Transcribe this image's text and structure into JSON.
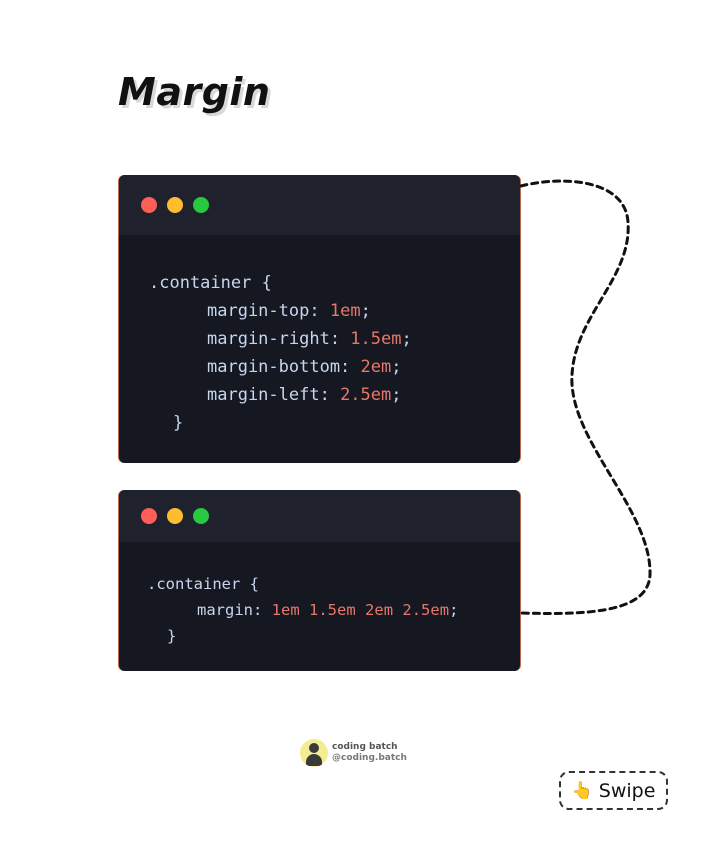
{
  "title": "Margin",
  "colors": {
    "window_bg": "#151821",
    "titlebar_bg": "#1f222c",
    "code_text": "#c7d6ee",
    "number_accent": "#e8776b",
    "dot_red": "#ff5f57",
    "dot_yellow": "#febc2e",
    "dot_green": "#28c840"
  },
  "window1": {
    "lines": [
      {
        "text": ".container {"
      },
      {
        "prop": "margin-top: ",
        "num": "1",
        "unit": "em",
        "end": ";"
      },
      {
        "prop": "margin-right: ",
        "num": "1.5",
        "unit": "em",
        "end": ";"
      },
      {
        "prop": "margin-bottom: ",
        "num": "2",
        "unit": "em",
        "end": ";"
      },
      {
        "prop": "margin-left: ",
        "num": "2.5",
        "unit": "em",
        "end": ";"
      },
      {
        "text": "}"
      }
    ]
  },
  "window2": {
    "line1": ".container {",
    "prop": "margin: ",
    "values": [
      {
        "num": "1",
        "unit": "em"
      },
      {
        "num": "1.5",
        "unit": "em"
      },
      {
        "num": "2",
        "unit": "em"
      },
      {
        "num": "2.5",
        "unit": "em"
      }
    ],
    "end": ";",
    "line3": "}"
  },
  "credit": {
    "name": "coding batch",
    "handle": "@coding.batch",
    "icon": "person-avatar-icon"
  },
  "swipe": {
    "label": "Swipe",
    "icon": "pointing-hand-icon",
    "icon_glyph": "👆"
  }
}
